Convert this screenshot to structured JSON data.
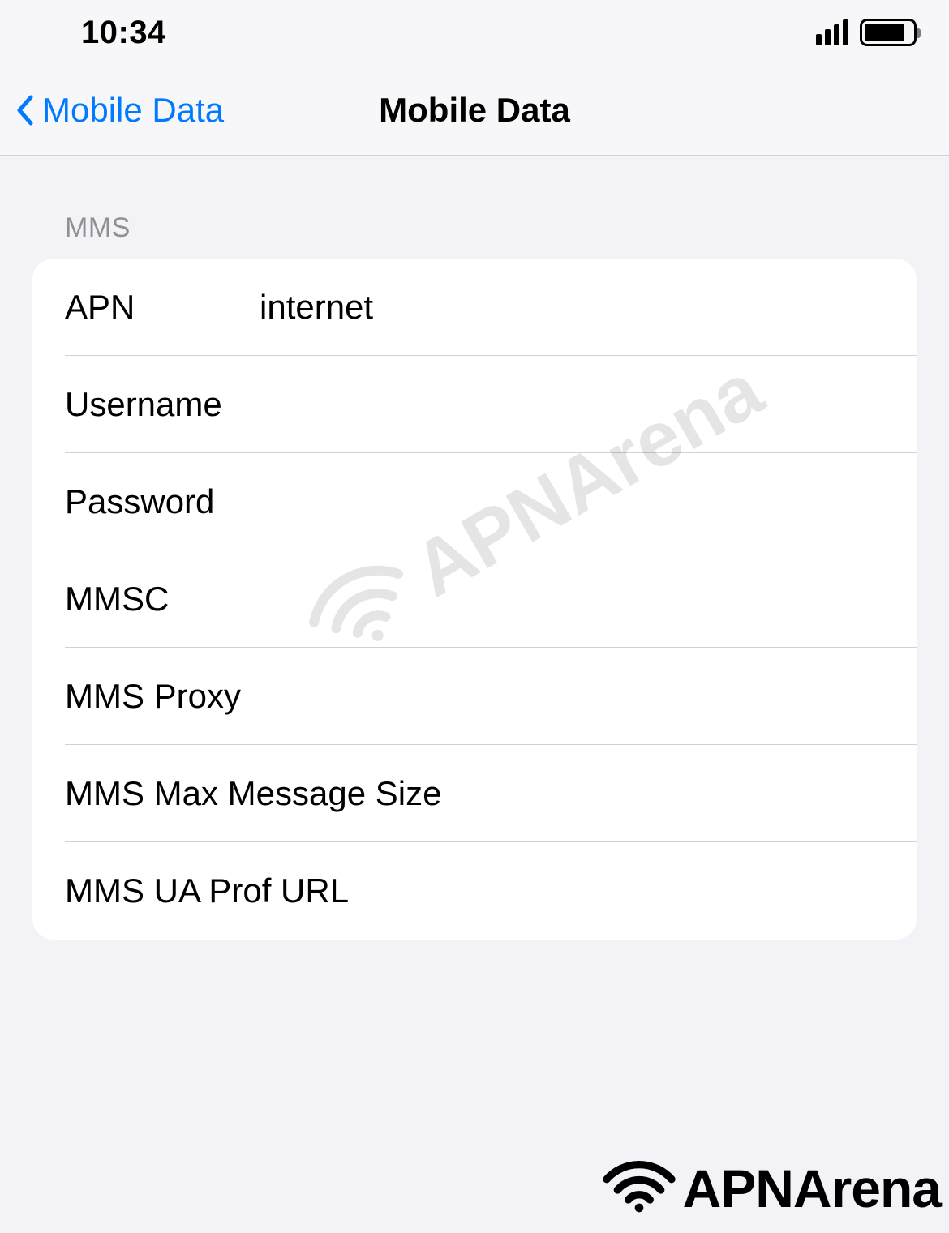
{
  "status_bar": {
    "time": "10:34"
  },
  "nav": {
    "back_label": "Mobile Data",
    "title": "Mobile Data"
  },
  "section": {
    "header": "MMS",
    "rows": [
      {
        "label": "APN",
        "value": "internet"
      },
      {
        "label": "Username",
        "value": ""
      },
      {
        "label": "Password",
        "value": ""
      },
      {
        "label": "MMSC",
        "value": ""
      },
      {
        "label": "MMS Proxy",
        "value": ""
      },
      {
        "label": "MMS Max Message Size",
        "value": ""
      },
      {
        "label": "MMS UA Prof URL",
        "value": ""
      }
    ]
  },
  "watermark": {
    "text": "APNArena"
  },
  "footer": {
    "text": "APNArena"
  }
}
